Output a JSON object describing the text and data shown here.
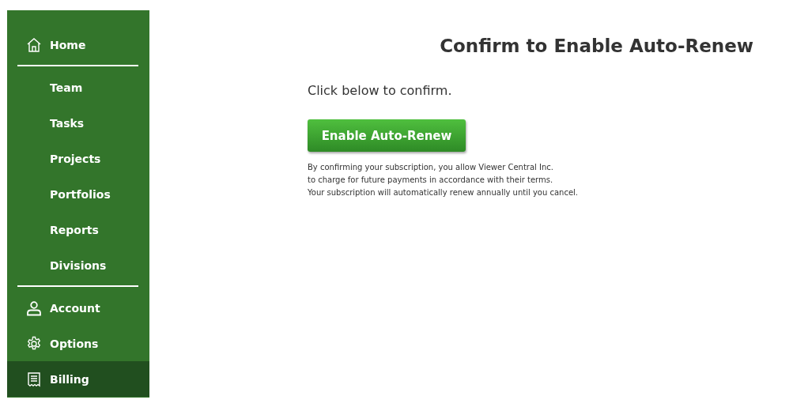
{
  "sidebar": {
    "sections": [
      [
        {
          "label": "Home",
          "selected": false
        }
      ],
      [
        {
          "label": "Team",
          "selected": false
        },
        {
          "label": "Tasks",
          "selected": false
        },
        {
          "label": "Projects",
          "selected": false
        },
        {
          "label": "Portfolios",
          "selected": false
        },
        {
          "label": "Reports",
          "selected": false
        },
        {
          "label": "Divisions",
          "selected": false
        }
      ],
      [
        {
          "label": "Account",
          "selected": false
        },
        {
          "label": "Options",
          "selected": false
        },
        {
          "label": "Billing",
          "selected": true
        }
      ]
    ]
  },
  "main": {
    "title": "Confirm to Enable Auto-Renew",
    "instruction": "Click below to confirm.",
    "button": "Enable Auto-Renew",
    "terms": [
      "By confirming your subscription, you allow Viewer Central Inc.",
      "to charge for future payments in accordance with their terms.",
      "Your subscription will automatically renew annually until you cancel."
    ]
  }
}
